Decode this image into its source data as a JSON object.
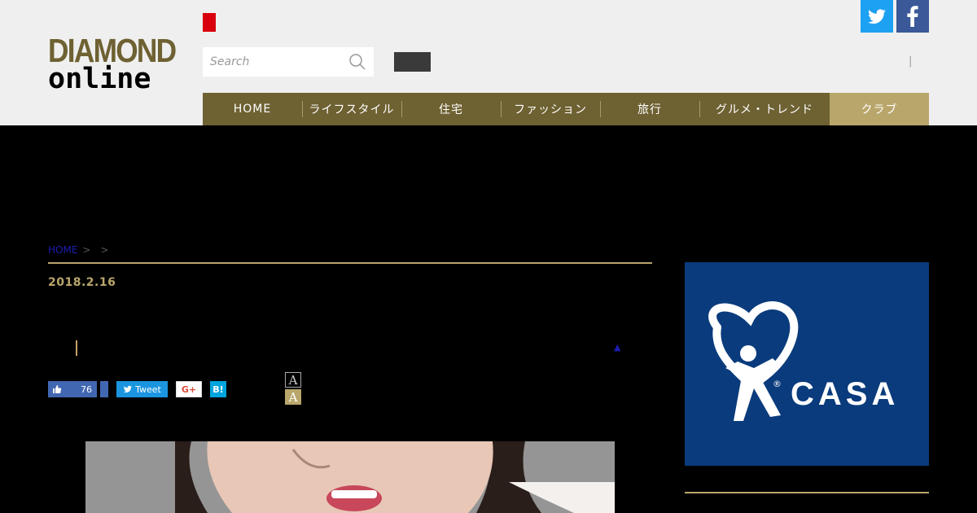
{
  "logo": {
    "line1": "DIAMOND",
    "line2": "online"
  },
  "search": {
    "placeholder": "Search"
  },
  "header": {
    "divider": "|"
  },
  "social": {
    "twitter_icon": "twitter-bird-icon",
    "facebook_icon": "facebook-f-icon"
  },
  "nav": {
    "items": [
      {
        "label": "HOME"
      },
      {
        "label": "ライフスタイル"
      },
      {
        "label": "住宅"
      },
      {
        "label": "ファッション"
      },
      {
        "label": "旅行"
      },
      {
        "label": "グルメ・トレンド"
      },
      {
        "label": "クラブ"
      }
    ]
  },
  "breadcrumb": {
    "home": "HOME",
    "sep1": ">",
    "sep2": ">"
  },
  "article": {
    "date": "2018.2.16",
    "up_arrow": "▲"
  },
  "share": {
    "like_count": "76",
    "tweet_label": "Tweet",
    "gplus_label": "G+",
    "hatena_label": "B!"
  },
  "font_size": {
    "small": "A",
    "large": "A"
  },
  "ad": {
    "brand": "CASA",
    "registered": "®"
  },
  "colors": {
    "brand_gold_dark": "#6e6132",
    "brand_gold_light": "#b9a66b",
    "header_bg": "#efefef",
    "ad_blue": "#0a3b7c"
  }
}
